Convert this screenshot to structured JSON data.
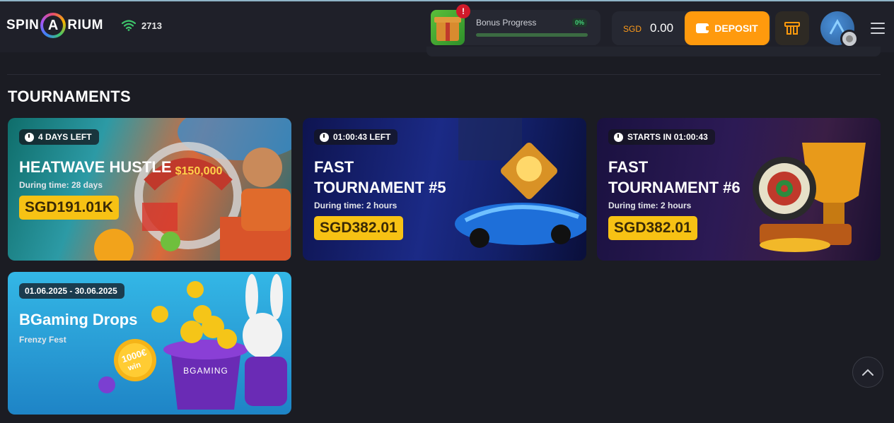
{
  "header": {
    "logo_left": "SPIN",
    "logo_mid": "A",
    "logo_right": "RIUM",
    "online_count": "2713",
    "bonus": {
      "label": "Bonus Progress",
      "percent": "0%",
      "alert": "!",
      "progress": 0
    },
    "wallet": {
      "currency": "SGD",
      "balance": "0.00"
    },
    "deposit_label": "DEPOSIT"
  },
  "section": {
    "title": "TOURNAMENTS"
  },
  "tournaments": [
    {
      "badge": "4 DAYS LEFT",
      "title": "HEATWAVE HUSTLE",
      "subtitle": "During time: 28 days",
      "prize": "SGD191.01K",
      "art_text": "$150,000"
    },
    {
      "badge": "01:00:43 LEFT",
      "title_line1": "FAST",
      "title_line2": "TOURNAMENT #5",
      "subtitle": "During time: 2 hours",
      "prize": "SGD382.01"
    },
    {
      "badge": "STARTS IN 01:00:43",
      "title_line1": "FAST",
      "title_line2": "TOURNAMENT #6",
      "subtitle": "During time: 2 hours",
      "prize": "SGD382.01"
    },
    {
      "badge": "01.06.2025 - 30.06.2025",
      "title": "BGaming Drops",
      "subtitle": "Frenzy Fest",
      "art_coin": "1000€",
      "art_coin_sub": "win",
      "art_brand": "BGAMING"
    }
  ],
  "colors": {
    "accent": "#ff9a0d",
    "prize_bg": "#f7c214",
    "background": "#1b1c23"
  }
}
